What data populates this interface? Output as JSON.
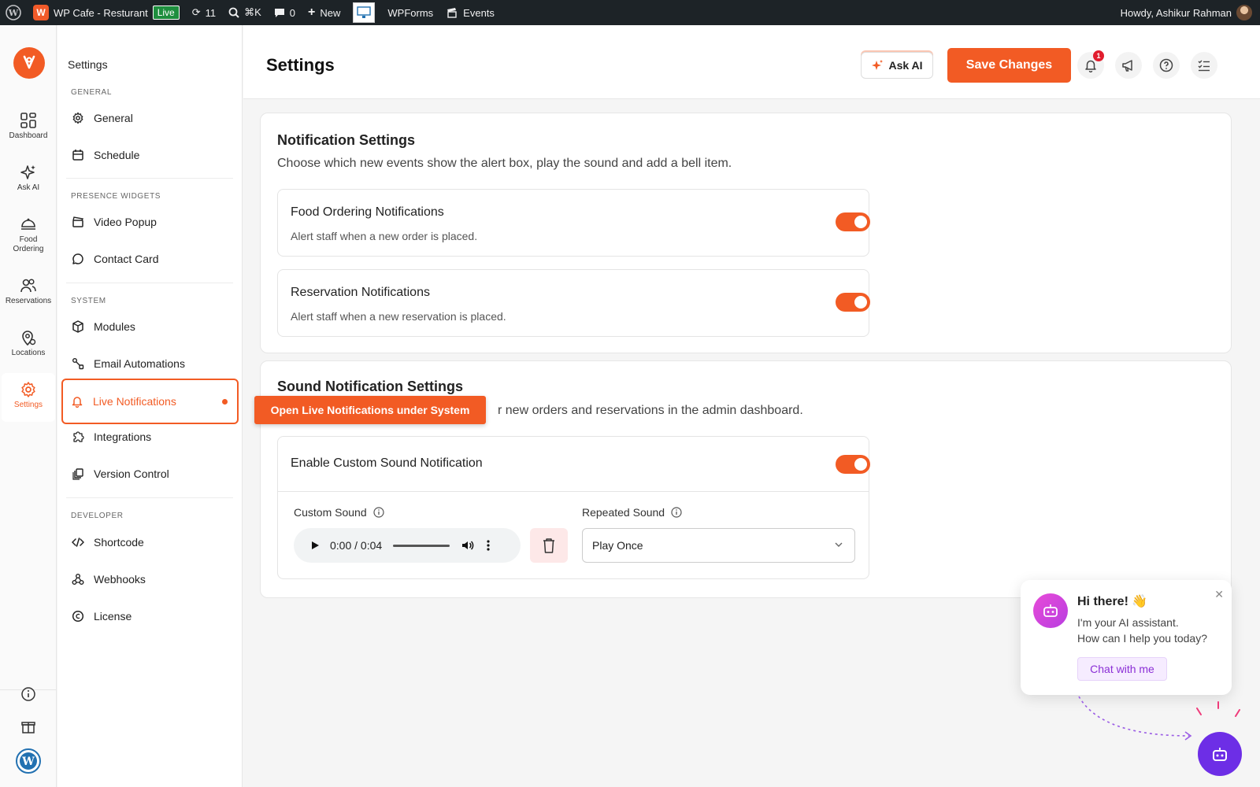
{
  "adminbar": {
    "site_name": "WP Cafe - Resturant",
    "live_badge": "Live",
    "updates_count": "11",
    "search_shortcut": "⌘K",
    "comments_count": "0",
    "new_label": "New",
    "wpforms_label": "WPForms",
    "events_label": "Events",
    "howdy": "Howdy, Ashikur Rahman"
  },
  "rail": {
    "items": [
      {
        "label": "Dashboard"
      },
      {
        "label": "Ask AI"
      },
      {
        "label": "Food Ordering"
      },
      {
        "label": "Reservations"
      },
      {
        "label": "Locations"
      },
      {
        "label": "Settings"
      }
    ]
  },
  "sidebar": {
    "title": "Settings",
    "sections": {
      "general": "GENERAL",
      "presence": "PRESENCE WIDGETS",
      "system": "SYSTEM",
      "developer": "DEVELOPER"
    },
    "items": {
      "general": "General",
      "schedule": "Schedule",
      "video_popup": "Video Popup",
      "contact_card": "Contact Card",
      "modules": "Modules",
      "email_automations": "Email Automations",
      "live_notifications": "Live Notifications",
      "integrations": "Integrations",
      "version_control": "Version Control",
      "shortcode": "Shortcode",
      "webhooks": "Webhooks",
      "license": "License"
    }
  },
  "header": {
    "title": "Settings",
    "ask_ai": "Ask AI",
    "save": "Save Changes",
    "notif_count": "1"
  },
  "notification_card": {
    "title": "Notification Settings",
    "desc": "Choose which new events show the alert box, play the sound and add a bell item.",
    "food": {
      "title": "Food Ordering Notifications",
      "desc": "Alert staff when a new order is placed.",
      "enabled": true
    },
    "reservation": {
      "title": "Reservation Notifications",
      "desc": "Alert staff when a new reservation is placed.",
      "enabled": true
    }
  },
  "sound_card": {
    "title": "Sound Notification Settings",
    "desc_visible": "r new orders and reservations in the admin dashboard.",
    "enable_label": "Enable Custom Sound Notification",
    "enabled": true,
    "custom_sound_label": "Custom Sound",
    "audio_time": "0:00 / 0:04",
    "repeated_label": "Repeated Sound",
    "repeated_value": "Play Once"
  },
  "tooltip": "Open Live Notifications under System",
  "chat": {
    "greeting": "Hi there! 👋",
    "line1": "I'm your AI assistant.",
    "line2": "How can I help you today?",
    "button": "Chat with me"
  },
  "colors": {
    "accent": "#f25b24",
    "chat_purple": "#6d2ee6"
  }
}
